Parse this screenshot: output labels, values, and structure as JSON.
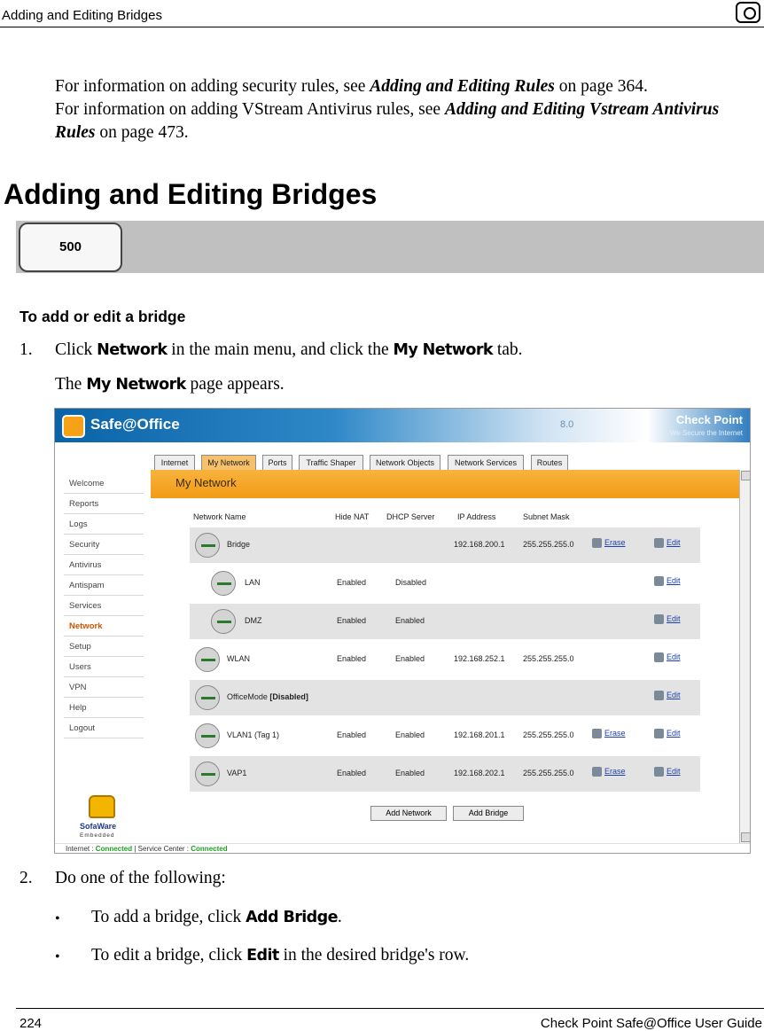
{
  "header": {
    "title": "Adding and Editing Bridges",
    "icon": "eye-icon"
  },
  "intro": {
    "line1_prefix": "For information on adding security rules, see ",
    "line1_link": "Adding and Editing Rules",
    "line1_suffix": " on page 364.",
    "line2_prefix": "For information on adding VStream Antivirus rules, see ",
    "line2_link": "Adding and Editing Vstream Antivirus Rules",
    "line2_suffix": " on page 473."
  },
  "heading": "Adding and Editing Bridges",
  "category_badge": "500",
  "procedure_title": "To add or edit a bridge",
  "steps": {
    "s1_num": "1.",
    "s1_a": "Click ",
    "s1_b": "Network",
    "s1_c": " in the main menu, and click the ",
    "s1_d": "My Network",
    "s1_e": " tab.",
    "s1_result_a": "The ",
    "s1_result_b": "My Network",
    "s1_result_c": " page appears.",
    "s2_num": "2.",
    "s2_text": "Do one of the following:",
    "b1_a": "To add a bridge, click ",
    "b1_b": "Add Bridge",
    "b1_c": ".",
    "b2_a": "To edit a bridge, click ",
    "b2_b": "Edit",
    "b2_c": " in the desired bridge's row.",
    "bullet": "•"
  },
  "screenshot": {
    "brand": "Safe@Office",
    "version": "8.0",
    "checkpoint": "Check Point",
    "checkpoint_sub": "We Secure the Internet",
    "menu": [
      "Welcome",
      "Reports",
      "Logs",
      "Security",
      "Antivirus",
      "Antispam",
      "Services",
      "Network",
      "Setup",
      "Users",
      "VPN",
      "Help",
      "Logout"
    ],
    "sofaware": "SofaWare",
    "embedded": "Embedded",
    "tabs": [
      "Internet",
      "My Network",
      "Ports",
      "Traffic Shaper",
      "Network Objects",
      "Network Services",
      "Routes"
    ],
    "page_title": "My Network",
    "columns": [
      "Network Name",
      "Hide NAT",
      "DHCP Server",
      "IP Address",
      "Subnet Mask"
    ],
    "rows": [
      {
        "name": "Bridge",
        "hide_nat": "",
        "dhcp": "",
        "ip": "192.168.200.1",
        "mask": "255.255.255.0",
        "erase": "Erase",
        "edit": "Edit"
      },
      {
        "name": "LAN",
        "hide_nat": "Enabled",
        "dhcp": "Disabled",
        "ip": "",
        "mask": "",
        "erase": "",
        "edit": "Edit"
      },
      {
        "name": "DMZ",
        "hide_nat": "Enabled",
        "dhcp": "Enabled",
        "ip": "",
        "mask": "",
        "erase": "",
        "edit": "Edit"
      },
      {
        "name": "WLAN",
        "hide_nat": "Enabled",
        "dhcp": "Enabled",
        "ip": "192.168.252.1",
        "mask": "255.255.255.0",
        "erase": "",
        "edit": "Edit"
      },
      {
        "name": "OfficeMode",
        "name_extra": "[Disabled]",
        "hide_nat": "",
        "dhcp": "",
        "ip": "",
        "mask": "",
        "erase": "",
        "edit": "Edit"
      },
      {
        "name": "VLAN1 (Tag 1)",
        "hide_nat": "Enabled",
        "dhcp": "Enabled",
        "ip": "192.168.201.1",
        "mask": "255.255.255.0",
        "erase": "Erase",
        "edit": "Edit"
      },
      {
        "name": "VAP1",
        "hide_nat": "Enabled",
        "dhcp": "Enabled",
        "ip": "192.168.202.1",
        "mask": "255.255.255.0",
        "erase": "Erase",
        "edit": "Edit"
      }
    ],
    "add_network": "Add Network",
    "add_bridge": "Add Bridge",
    "status_internet_label": "Internet : ",
    "status_internet": "Connected",
    "status_sep": " | ",
    "status_service_label": "Service Center : ",
    "status_service": "Connected"
  },
  "footer": {
    "page": "224",
    "guide": "Check Point Safe@Office User Guide"
  }
}
